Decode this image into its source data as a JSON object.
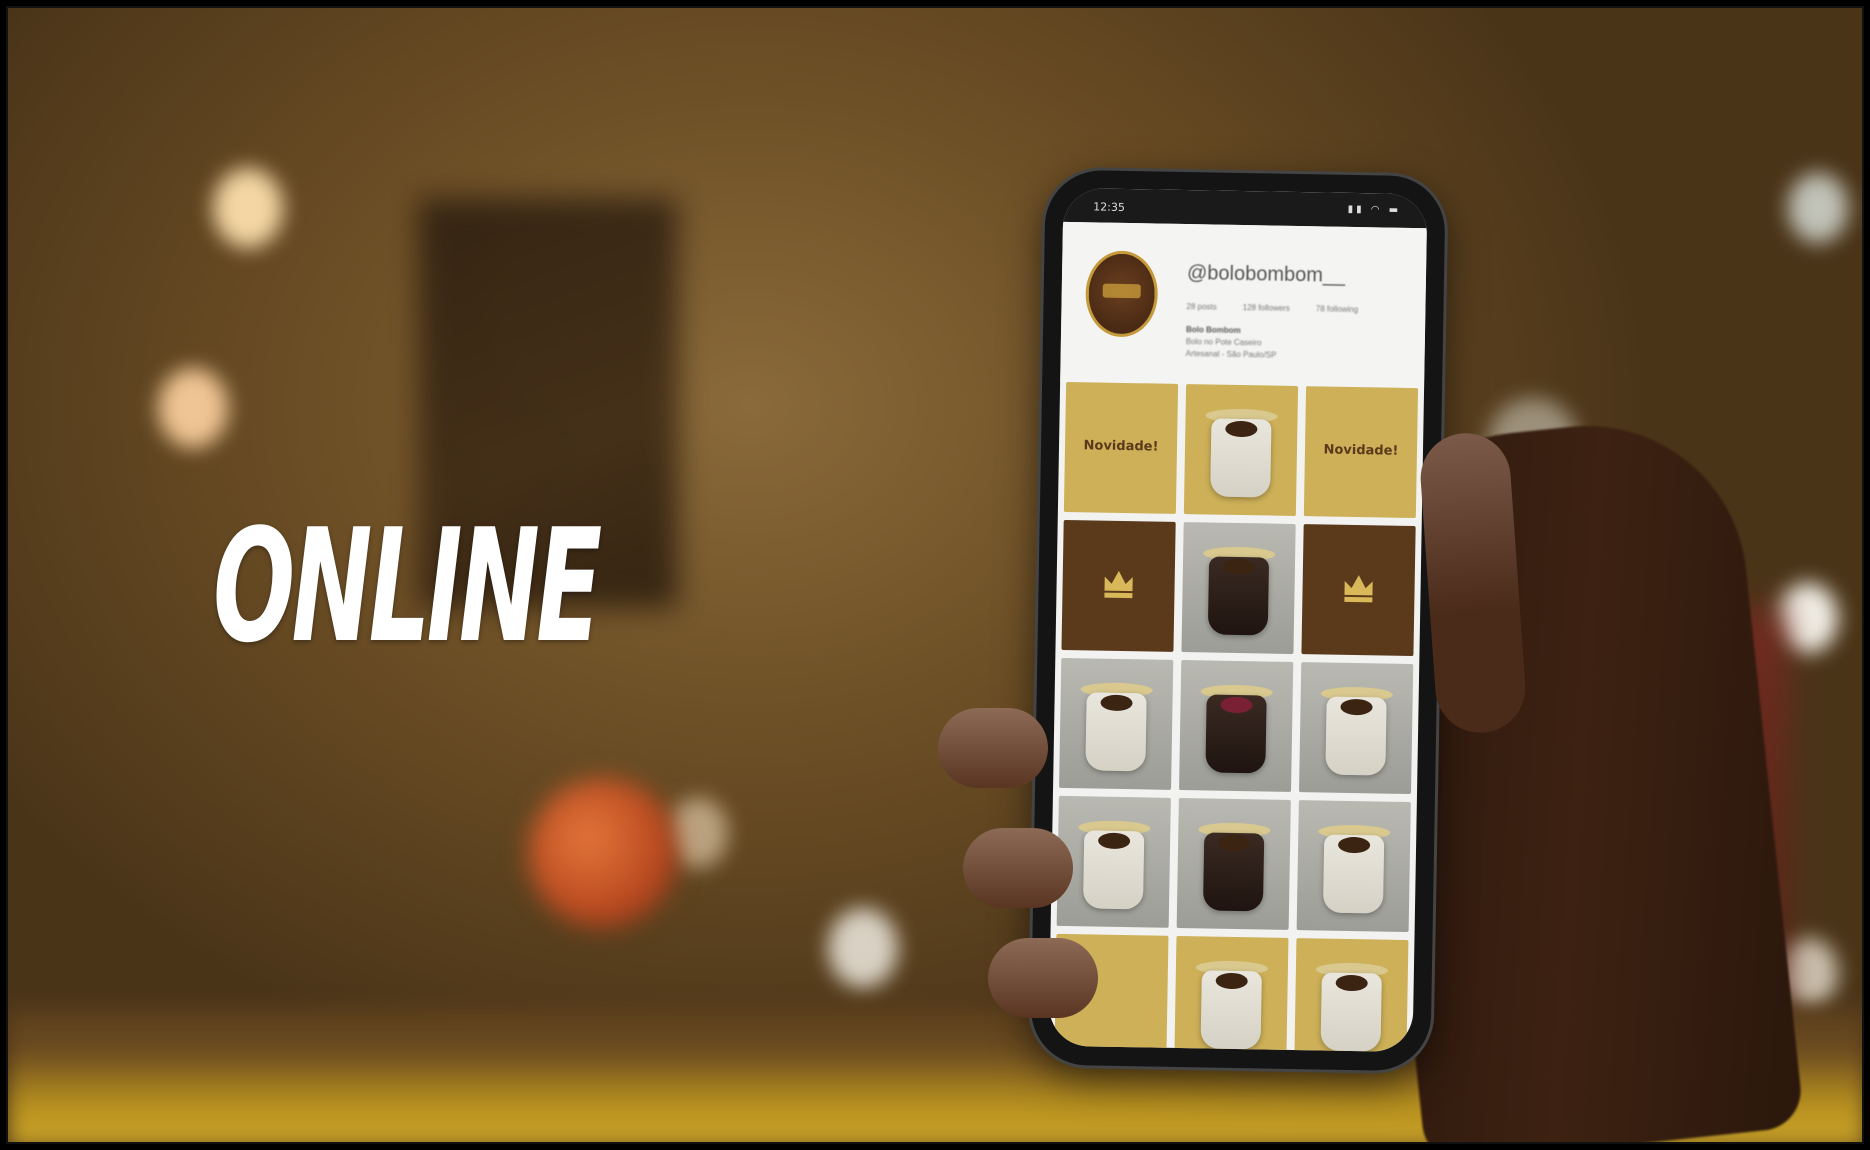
{
  "overlay": {
    "title": "ONLINE"
  },
  "phone": {
    "status_bar": {
      "time": "12:35",
      "icons": "▮▮ ◠ ▬"
    },
    "profile": {
      "handle": "@bolobombom__",
      "stats": [
        "28 posts",
        "128 followers",
        "78 following"
      ],
      "bio_name": "Bolo Bombom",
      "bio_lines": [
        "Bolo no Pote Caseiro",
        "Artesanal - São Paulo/SP"
      ]
    },
    "grid": [
      {
        "kind": "yellow",
        "label": "Novidade!"
      },
      {
        "kind": "yellow-cup",
        "label": ""
      },
      {
        "kind": "yellow",
        "label": "Novidade!"
      },
      {
        "kind": "brown-crown",
        "label": ""
      },
      {
        "kind": "photo-dark",
        "label": ""
      },
      {
        "kind": "brown-crown",
        "label": ""
      },
      {
        "kind": "photo-light",
        "label": ""
      },
      {
        "kind": "photo-red",
        "label": ""
      },
      {
        "kind": "photo-light",
        "label": ""
      },
      {
        "kind": "photo-light",
        "label": ""
      },
      {
        "kind": "photo-dark",
        "label": ""
      },
      {
        "kind": "photo-light",
        "label": ""
      },
      {
        "kind": "yellow",
        "label": ""
      },
      {
        "kind": "yellow-cup",
        "label": ""
      },
      {
        "kind": "yellow-cup",
        "label": ""
      }
    ]
  },
  "colors": {
    "brand_yellow": "#cdb058",
    "brand_brown": "#5b3a1c",
    "title_text": "#ffffff"
  }
}
